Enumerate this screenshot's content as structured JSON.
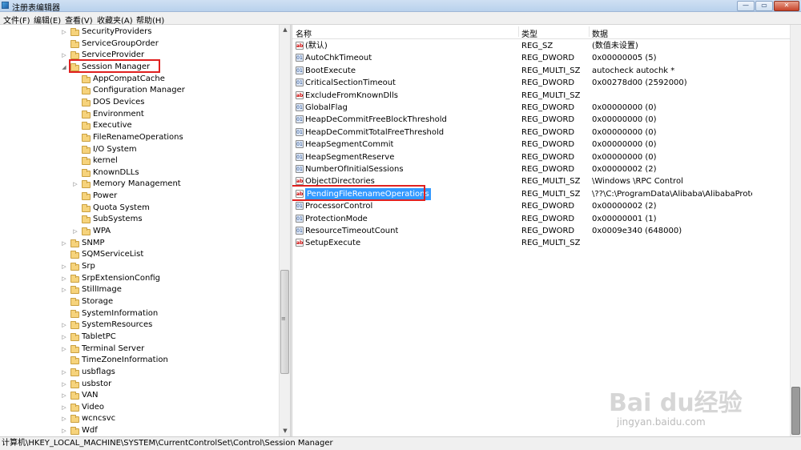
{
  "window": {
    "title": "注册表编辑器",
    "buttons": [
      "—",
      "▭",
      "✕"
    ]
  },
  "menu": [
    "文件(F)",
    "编辑(E)",
    "查看(V)",
    "收藏夹(A)",
    "帮助(H)"
  ],
  "tree": [
    {
      "label": "SecurityProviders",
      "expander": "▷",
      "level": 0
    },
    {
      "label": "ServiceGroupOrder",
      "expander": "",
      "level": 0
    },
    {
      "label": "ServiceProvider",
      "expander": "▷",
      "level": 0
    },
    {
      "label": "Session Manager",
      "expander": "◢",
      "level": 0,
      "highlighted": true
    },
    {
      "label": "AppCompatCache",
      "expander": "",
      "level": 1
    },
    {
      "label": "Configuration Manager",
      "expander": "",
      "level": 1
    },
    {
      "label": "DOS Devices",
      "expander": "",
      "level": 1
    },
    {
      "label": "Environment",
      "expander": "",
      "level": 1
    },
    {
      "label": "Executive",
      "expander": "",
      "level": 1
    },
    {
      "label": "FileRenameOperations",
      "expander": "",
      "level": 1
    },
    {
      "label": "I/O System",
      "expander": "",
      "level": 1
    },
    {
      "label": "kernel",
      "expander": "",
      "level": 1
    },
    {
      "label": "KnownDLLs",
      "expander": "",
      "level": 1
    },
    {
      "label": "Memory Management",
      "expander": "▷",
      "level": 1
    },
    {
      "label": "Power",
      "expander": "",
      "level": 1
    },
    {
      "label": "Quota System",
      "expander": "",
      "level": 1
    },
    {
      "label": "SubSystems",
      "expander": "",
      "level": 1
    },
    {
      "label": "WPA",
      "expander": "▷",
      "level": 1
    },
    {
      "label": "SNMP",
      "expander": "▷",
      "level": 0
    },
    {
      "label": "SQMServiceList",
      "expander": "",
      "level": 0
    },
    {
      "label": "Srp",
      "expander": "▷",
      "level": 0
    },
    {
      "label": "SrpExtensionConfig",
      "expander": "▷",
      "level": 0
    },
    {
      "label": "StillImage",
      "expander": "▷",
      "level": 0
    },
    {
      "label": "Storage",
      "expander": "",
      "level": 0
    },
    {
      "label": "SystemInformation",
      "expander": "",
      "level": 0
    },
    {
      "label": "SystemResources",
      "expander": "▷",
      "level": 0
    },
    {
      "label": "TabletPC",
      "expander": "▷",
      "level": 0
    },
    {
      "label": "Terminal Server",
      "expander": "▷",
      "level": 0
    },
    {
      "label": "TimeZoneInformation",
      "expander": "",
      "level": 0
    },
    {
      "label": "usbflags",
      "expander": "▷",
      "level": 0
    },
    {
      "label": "usbstor",
      "expander": "▷",
      "level": 0
    },
    {
      "label": "VAN",
      "expander": "▷",
      "level": 0
    },
    {
      "label": "Video",
      "expander": "▷",
      "level": 0
    },
    {
      "label": "wcncsvc",
      "expander": "▷",
      "level": 0
    },
    {
      "label": "Wdf",
      "expander": "▷",
      "level": 0
    }
  ],
  "list": {
    "headers": {
      "name": "名称",
      "type": "类型",
      "data": "数据"
    },
    "rows": [
      {
        "icon": "ab",
        "name": "(默认)",
        "type": "REG_SZ",
        "data": "(数值未设置)"
      },
      {
        "icon": "bin",
        "name": "AutoChkTimeout",
        "type": "REG_DWORD",
        "data": "0x00000005 (5)"
      },
      {
        "icon": "bin",
        "name": "BootExecute",
        "type": "REG_MULTI_SZ",
        "data": "autocheck autochk *"
      },
      {
        "icon": "bin",
        "name": "CriticalSectionTimeout",
        "type": "REG_DWORD",
        "data": "0x00278d00 (2592000)"
      },
      {
        "icon": "ab",
        "name": "ExcludeFromKnownDlls",
        "type": "REG_MULTI_SZ",
        "data": ""
      },
      {
        "icon": "bin",
        "name": "GlobalFlag",
        "type": "REG_DWORD",
        "data": "0x00000000 (0)"
      },
      {
        "icon": "bin",
        "name": "HeapDeCommitFreeBlockThreshold",
        "type": "REG_DWORD",
        "data": "0x00000000 (0)"
      },
      {
        "icon": "bin",
        "name": "HeapDeCommitTotalFreeThreshold",
        "type": "REG_DWORD",
        "data": "0x00000000 (0)"
      },
      {
        "icon": "bin",
        "name": "HeapSegmentCommit",
        "type": "REG_DWORD",
        "data": "0x00000000 (0)"
      },
      {
        "icon": "bin",
        "name": "HeapSegmentReserve",
        "type": "REG_DWORD",
        "data": "0x00000000 (0)"
      },
      {
        "icon": "bin",
        "name": "NumberOfInitialSessions",
        "type": "REG_DWORD",
        "data": "0x00000002 (2)"
      },
      {
        "icon": "ab",
        "name": "ObjectDirectories",
        "type": "REG_MULTI_SZ",
        "data": "\\Windows \\RPC Control"
      },
      {
        "icon": "ab",
        "name": "PendingFileRenameOperations",
        "type": "REG_MULTI_SZ",
        "data": "\\??\\C:\\ProgramData\\Alibaba\\AlibabaProtectD...",
        "selected": true
      },
      {
        "icon": "bin",
        "name": "ProcessorControl",
        "type": "REG_DWORD",
        "data": "0x00000002 (2)"
      },
      {
        "icon": "bin",
        "name": "ProtectionMode",
        "type": "REG_DWORD",
        "data": "0x00000001 (1)"
      },
      {
        "icon": "bin",
        "name": "ResourceTimeoutCount",
        "type": "REG_DWORD",
        "data": "0x0009e340 (648000)"
      },
      {
        "icon": "ab",
        "name": "SetupExecute",
        "type": "REG_MULTI_SZ",
        "data": ""
      }
    ]
  },
  "statusbar": "计算机\\HKEY_LOCAL_MACHINE\\SYSTEM\\CurrentControlSet\\Control\\Session Manager",
  "watermark": {
    "brand": "Bai du经验",
    "url": "jingyan.baidu.com"
  },
  "colors": {
    "highlight_box": "#e0201f",
    "selection": "#3399ff",
    "folder": "#f6d37c"
  }
}
